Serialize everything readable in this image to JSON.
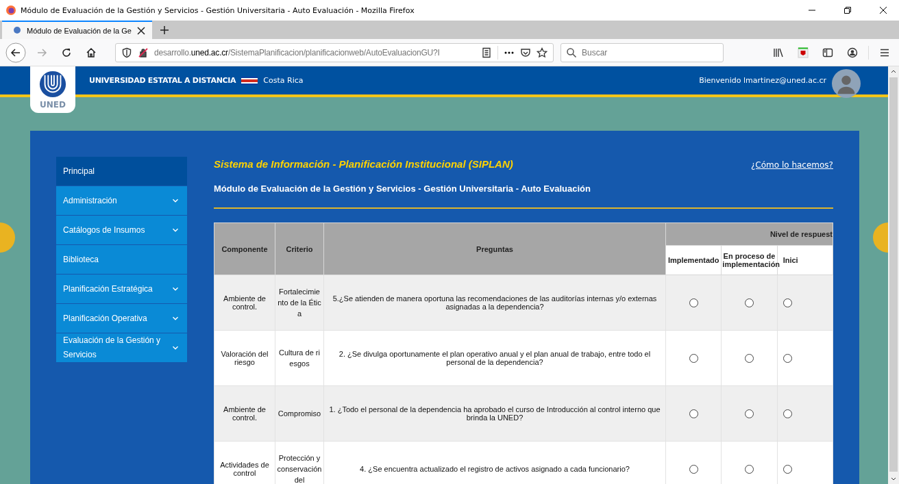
{
  "window": {
    "title": "Módulo de Evaluación de la Gestión y Servicios - Gestión Universitaria - Auto Evaluación - Mozilla Firefox"
  },
  "tabs": [
    {
      "label": "Módulo de Evaluación de la Ge",
      "selected": true
    }
  ],
  "address_bar": {
    "url_host_prefix": "desarrollo.",
    "url_host": "uned.ac.cr",
    "url_path": "/SistemaPlanificacion/planificacionweb/AutoEvaluacionGU?I"
  },
  "search": {
    "placeholder": "Buscar"
  },
  "header": {
    "logo_text": "UNED",
    "university": "UNIVERSIDAD ESTATAL A DISTANCIA",
    "country": "Costa Rica",
    "welcome": "Bienvenido lmartinez@uned.ac.cr"
  },
  "sidebar": {
    "items": [
      {
        "label": "Principal",
        "selected": true,
        "has_submenu": false
      },
      {
        "label": "Administración",
        "selected": false,
        "has_submenu": true
      },
      {
        "label": "Catálogos de Insumos",
        "selected": false,
        "has_submenu": true
      },
      {
        "label": "Biblioteca",
        "selected": false,
        "has_submenu": false
      },
      {
        "label": "Planificación Estratégica",
        "selected": false,
        "has_submenu": true
      },
      {
        "label": "Planificación Operativa",
        "selected": false,
        "has_submenu": true
      },
      {
        "label": "Evaluación de la Gestión y Servicios",
        "selected": false,
        "has_submenu": true
      }
    ]
  },
  "content": {
    "system_title": "Sistema de Información - Planificación Institucional (SIPLAN)",
    "help_link": "¿Cómo lo hacemos?",
    "module_title": "Módulo de Evaluación de la Gestión y Servicios - Gestión Universitaria - Auto Evaluación"
  },
  "table": {
    "columns": [
      "Componente",
      "Criterio",
      "Preguntas"
    ],
    "group_header": "Nivel de respuest",
    "levels": [
      "Implementado",
      "En proceso de implementación",
      "Inici"
    ],
    "rows": [
      {
        "componente": "Ambiente de control.",
        "criterio": "Fortalecimiento de la Ética",
        "pregunta": "5.¿Se atienden de manera oportuna las recomendaciones de las auditorías internas y/o externas asignadas a la dependencia?",
        "answers": [
          {
            "selected": false
          },
          {
            "selected": false
          },
          {
            "selected": false
          }
        ]
      },
      {
        "componente": "Valoración del riesgo",
        "criterio": "Cultura de riesgos",
        "pregunta": "2. ¿Se divulga oportunamente el plan operativo anual y el plan anual de trabajo, entre todo el personal de la dependencia?",
        "answers": [
          {
            "selected": false
          },
          {
            "selected": false
          },
          {
            "selected": false
          }
        ]
      },
      {
        "componente": "Ambiente de control.",
        "criterio": "Compromiso",
        "pregunta": "1. ¿Todo el personal de la dependencia ha aprobado el curso de Introducción al control interno que brinda la UNED?",
        "answers": [
          {
            "selected": false
          },
          {
            "selected": false
          },
          {
            "selected": false
          }
        ]
      },
      {
        "componente": "Actividades de control",
        "criterio": "Protección y conservación del",
        "pregunta": "4. ¿Se encuentra actualizado el registro de activos asignado a cada funcionario?",
        "answers": [
          {
            "selected": false
          },
          {
            "selected": false
          },
          {
            "selected": false
          }
        ]
      }
    ]
  }
}
